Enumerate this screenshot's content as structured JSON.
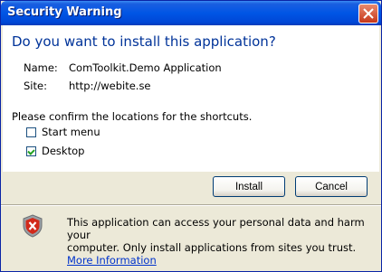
{
  "window": {
    "title": "Security Warning"
  },
  "dialog": {
    "heading": "Do you want to install this application?",
    "name_label": "Name:",
    "name_value": "ComToolkit.Demo Application",
    "site_label": "Site:",
    "site_value": "http://webite.se",
    "confirm_text": "Please confirm the locations for the shortcuts.",
    "shortcuts": [
      {
        "label": "Start menu",
        "checked": false
      },
      {
        "label": "Desktop",
        "checked": true
      }
    ]
  },
  "buttons": {
    "install": "Install",
    "cancel": "Cancel"
  },
  "warning": {
    "text_line1": "This application can access your personal data and harm your",
    "text_line2": "computer. Only install applications from sites you trust.",
    "link": "More Information",
    "icon": "shield-warning-icon"
  }
}
